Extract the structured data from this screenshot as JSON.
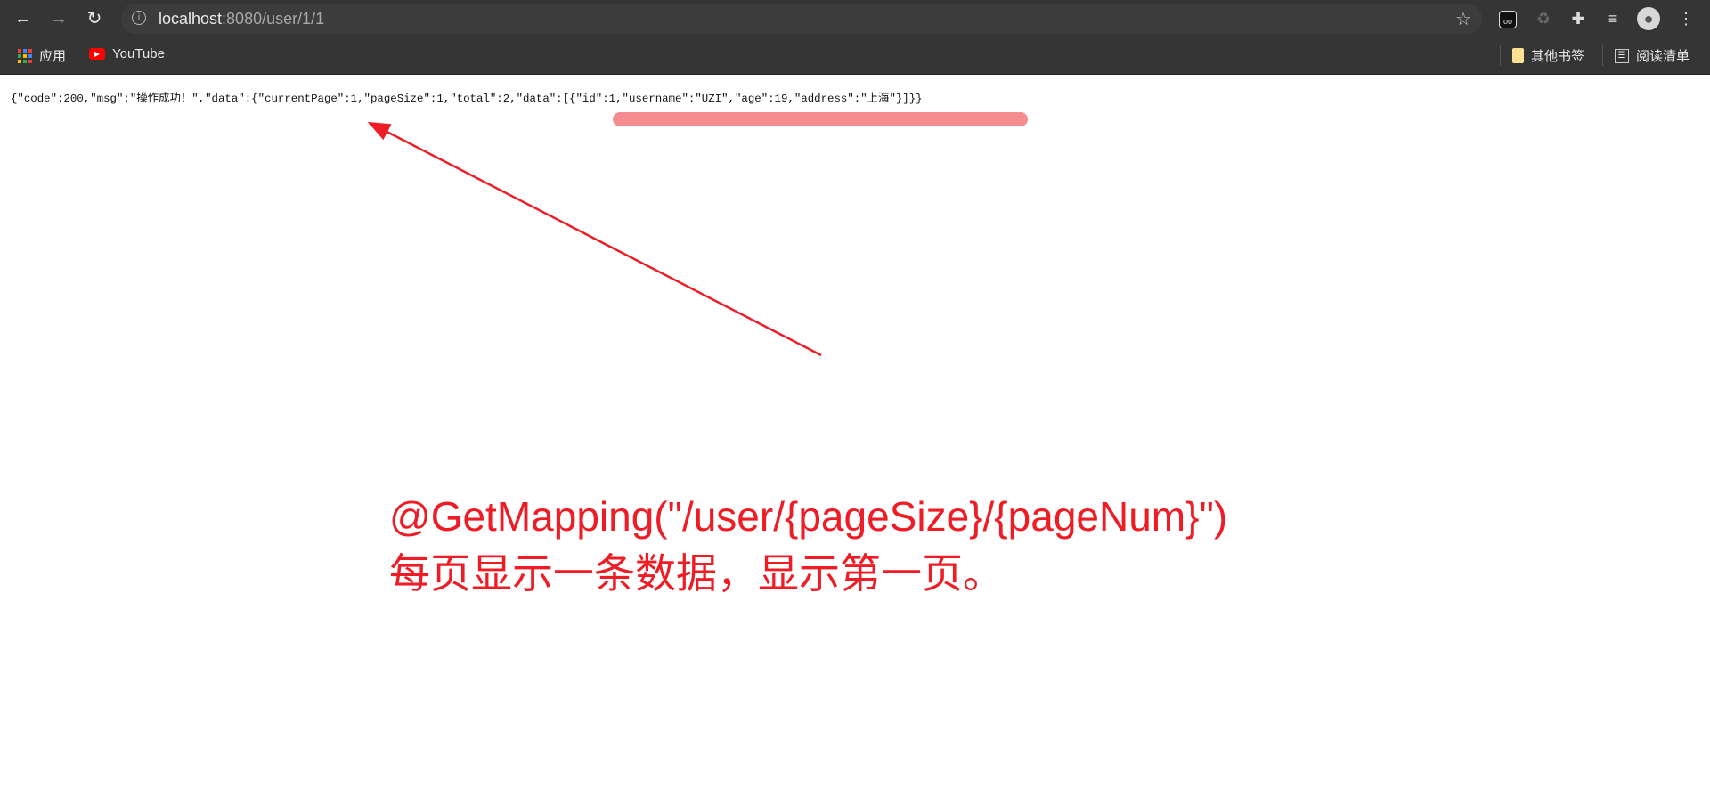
{
  "browser": {
    "url_host": "localhost",
    "url_rest": ":8080/user/1/1",
    "bookmarks": [
      {
        "label": "应用",
        "icon": "apps-grid-icon"
      },
      {
        "label": "YouTube",
        "icon": "youtube-icon"
      }
    ],
    "other_bookmarks": "其他书签",
    "reading_list": "阅读清单"
  },
  "page": {
    "json_text": "{\"code\":200,\"msg\":\"操作成功！\",\"data\":{\"currentPage\":1,\"pageSize\":1,\"total\":2,\"data\":[{\"id\":1,\"username\":\"UZI\",\"age\":19,\"address\":\"上海\"}]}}"
  },
  "annotation": {
    "line1": "@GetMapping(\"/user/{pageSize}/{pageNum}\")",
    "line2": "每页显示一条数据，显示第一页。",
    "color": "#ee1c25",
    "highlight_color": "#f58c90"
  }
}
